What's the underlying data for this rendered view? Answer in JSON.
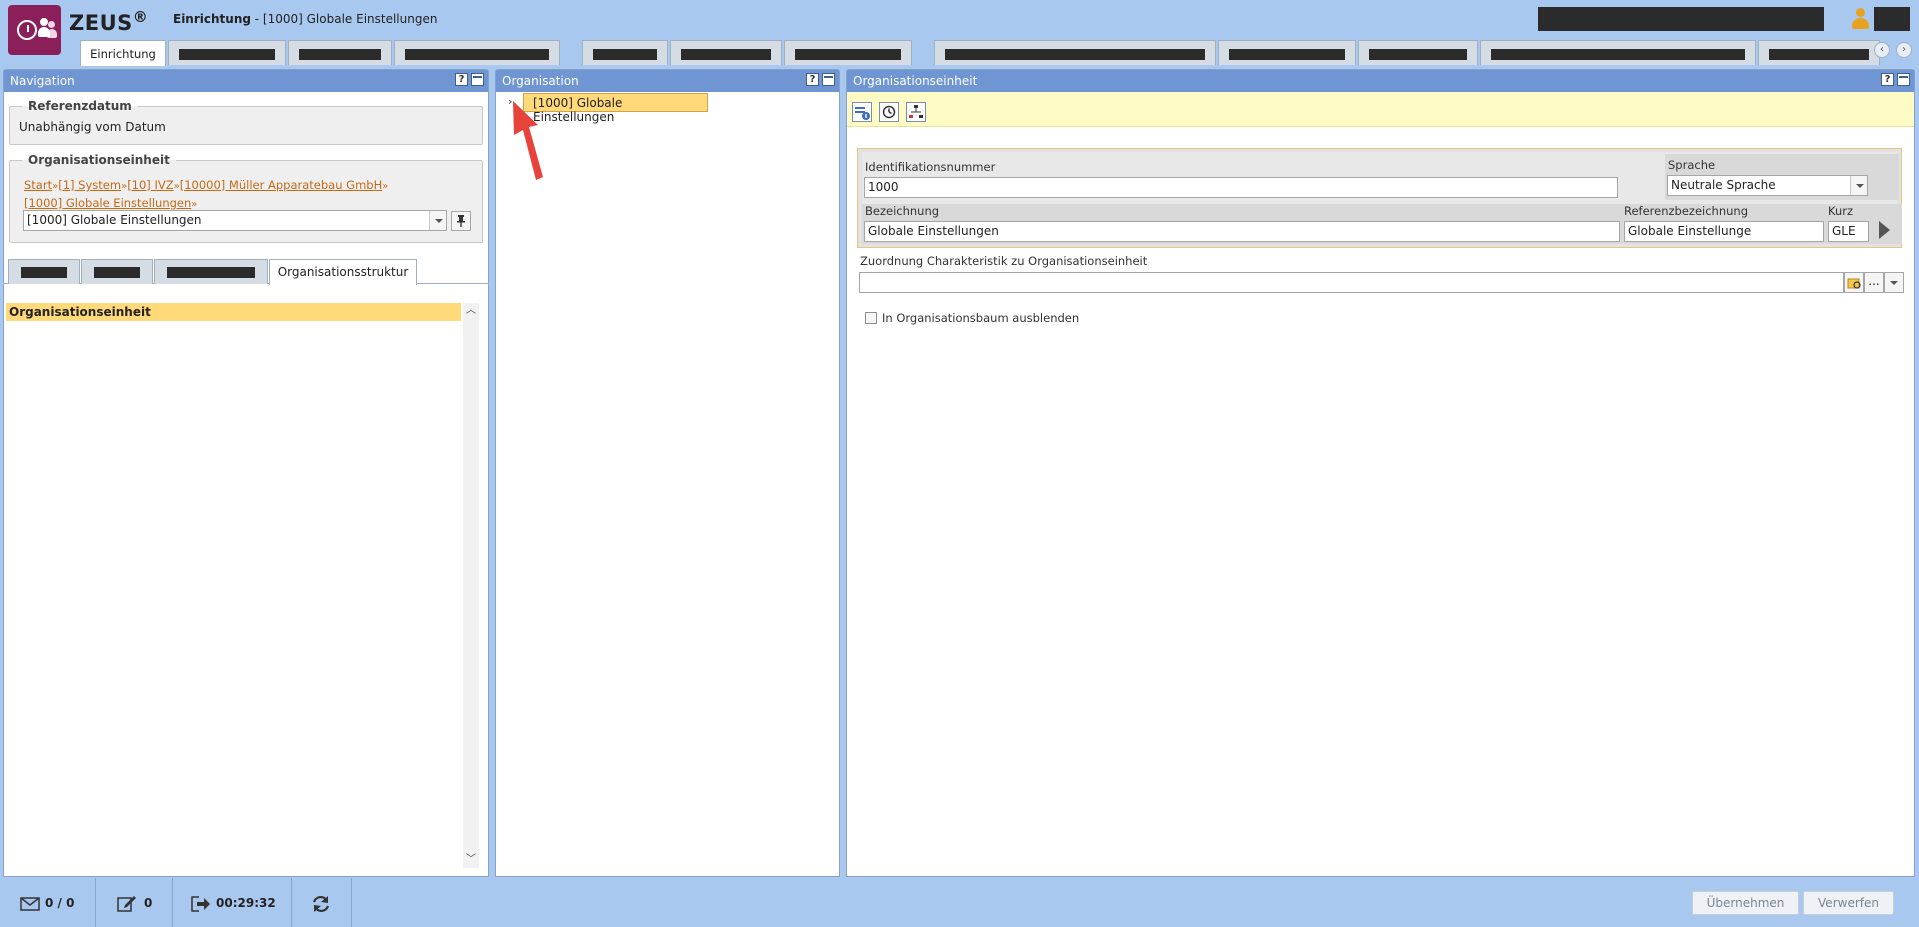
{
  "header": {
    "brand": "ZEUS",
    "brand_mark": "®",
    "title_bold": "Einrichtung",
    "title_rest": " - [1000] Globale Einstellungen"
  },
  "tabs": {
    "active_label": "Einrichtung"
  },
  "navigation": {
    "title": "Navigation",
    "help": "?",
    "referenzdatum": {
      "legend": "Referenzdatum",
      "value": "Unabhängig vom Datum"
    },
    "orgeinheit": {
      "legend": "Organisationseinheit",
      "crumbs": [
        "Start",
        "[1] System",
        "[10] IVZ",
        "[10000] Müller Apparatebau GmbH",
        "[1000] Globale Einstellungen"
      ],
      "sep": "»",
      "selected": "[1000] Globale Einstellungen"
    },
    "subtab_active": "Organisationsstruktur",
    "list_header": "Organisationseinheit"
  },
  "organisation": {
    "title": "Organisation",
    "help": "?",
    "tree_node": "[1000] Globale Einstellungen"
  },
  "orgunit": {
    "title": "Organisationseinheit",
    "help": "?",
    "id_label": "Identifikationsnummer",
    "id_value": "1000",
    "lang_label": "Sprache",
    "lang_value": "Neutrale Sprache",
    "bez_label": "Bezeichnung",
    "bez_value": "Globale Einstellungen",
    "refbez_label": "Referenzbezeichnung",
    "refbez_value": "Globale Einstellunge",
    "kurz_label": "Kurz",
    "kurz_value": "GLE",
    "zuordnung_label": "Zuordnung Charakteristik zu Organisationseinheit",
    "zuordnung_value": "",
    "ellipsis": "...",
    "checkbox_label": "In Organisationsbaum ausblenden"
  },
  "status": {
    "messages": "0 / 0",
    "tasks": "0",
    "session_time": "00:29:32"
  },
  "buttons": {
    "apply": "Übernehmen",
    "discard": "Verwerfen"
  },
  "colors": {
    "background": "#a9c8ef",
    "panel_header": "#6f96d3",
    "highlight": "#ffd97a",
    "logo": "#8b1f5a",
    "link": "#c46a16"
  }
}
